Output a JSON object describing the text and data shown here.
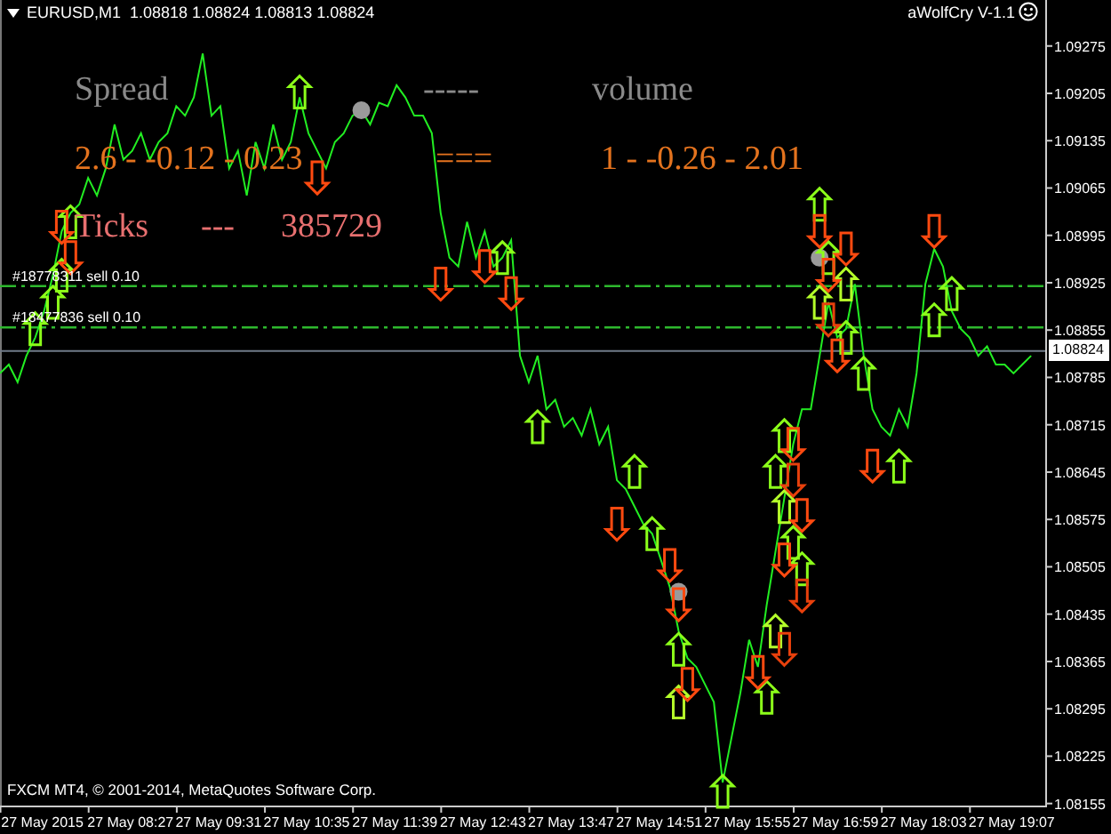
{
  "header": {
    "title": "EURUSD,M1  1.08818 1.08824 1.08813 1.08824",
    "expert": "aWolfCry V-1.1"
  },
  "indicator_rows": [
    {
      "color": "#8a8a8a",
      "cells": [
        "Spread",
        "-----",
        "volume"
      ]
    },
    {
      "color": "#e4731e",
      "cells": [
        "2.6 - -0.12 - 0.23",
        "===",
        "1 - -0.26 - 2.01"
      ]
    },
    {
      "color": "#e87070",
      "cells": [
        "Ticks",
        "---",
        "385729"
      ]
    }
  ],
  "copyright": "FXCM MT4, © 2001-2014, MetaQuotes Software Corp.",
  "chart_data": {
    "type": "line",
    "ylim": [
      1.08152,
      1.09343
    ],
    "categories": [
      null,
      null,
      null,
      null,
      null,
      "27 May 2015",
      null,
      null,
      null,
      null,
      null,
      null,
      null,
      null,
      null,
      "27 May 08:27",
      null,
      null,
      null,
      null,
      null,
      null,
      null,
      null,
      null,
      "27 May 09:31",
      null,
      null,
      null,
      null,
      null,
      null,
      null,
      null,
      null,
      "27 May 10:35",
      null,
      null,
      null,
      null,
      null,
      null,
      null,
      null,
      null,
      "27 May 11:39",
      null,
      null,
      null,
      null,
      null,
      null,
      null,
      null,
      null,
      "27 May 12:43",
      null,
      null,
      null,
      null,
      null,
      null,
      null,
      null,
      null,
      "27 May 13:47",
      null,
      null,
      null,
      null,
      null,
      null,
      null,
      null,
      null,
      "27 May 14:51",
      null,
      null,
      null,
      null,
      null,
      null,
      null,
      null,
      null,
      "27 May 15:55",
      null,
      null,
      null,
      null,
      null,
      null,
      null,
      null,
      null,
      "27 May 16:59",
      null,
      null,
      null,
      null,
      null,
      null,
      null,
      null,
      null,
      "27 May 18:03",
      null,
      null,
      null,
      null,
      null,
      null,
      null,
      null,
      null,
      "27 May 19:07",
      null,
      null
    ],
    "series": [
      {
        "color": "#22ee22",
        "values": [
          1.08791,
          1.08804,
          1.08778,
          1.08817,
          1.08844,
          1.08883,
          1.08936,
          1.09001,
          1.09028,
          1.09041,
          1.0908,
          1.09054,
          1.09094,
          1.09159,
          1.09107,
          1.0912,
          1.09146,
          1.09107,
          1.09133,
          1.09146,
          1.09186,
          1.09172,
          1.09199,
          1.09264,
          1.09172,
          1.09186,
          1.09094,
          1.0912,
          1.09054,
          1.09133,
          1.09094,
          1.09159,
          1.09107,
          1.09133,
          1.09199,
          1.09146,
          1.0912,
          1.09094,
          1.09133,
          1.09146,
          1.09172,
          1.0918,
          1.09159,
          1.09191,
          1.09186,
          1.09217,
          1.09199,
          1.09172,
          1.09172,
          1.09146,
          1.09028,
          1.08962,
          1.08949,
          1.09015,
          1.08962,
          1.09001,
          1.08949,
          1.08962,
          1.08988,
          1.08817,
          1.08778,
          1.08817,
          1.08738,
          1.08752,
          1.08712,
          1.08725,
          1.08699,
          1.08738,
          1.08686,
          1.08712,
          1.08633,
          1.0862,
          1.08594,
          1.08568,
          1.08554,
          1.08515,
          1.08475,
          1.0841,
          1.0837,
          1.08357,
          1.08331,
          1.08305,
          1.08186,
          1.08252,
          1.08318,
          1.08397,
          1.08357,
          1.08449,
          1.08528,
          1.08607,
          1.08686,
          1.08738,
          1.08738,
          1.08817,
          1.08896,
          1.08844,
          1.08857,
          1.08923,
          1.08817,
          1.08738,
          1.08712,
          1.08699,
          1.08738,
          1.08712,
          1.08791,
          1.08923,
          1.08975,
          1.08949,
          1.08883,
          1.08857,
          1.08844,
          1.08817,
          1.08831,
          1.08804,
          1.08804,
          1.08791,
          1.08804,
          1.08817
        ]
      },
      {
        "type": "scatter",
        "color": "#9a9a9a",
        "values": [
          null,
          null,
          null,
          null,
          null,
          null,
          null,
          null,
          null,
          null,
          null,
          null,
          null,
          null,
          null,
          null,
          null,
          null,
          null,
          null,
          null,
          null,
          null,
          null,
          null,
          null,
          null,
          null,
          null,
          null,
          null,
          null,
          null,
          null,
          null,
          null,
          null,
          null,
          null,
          null,
          null,
          1.0918,
          null,
          null,
          null,
          null,
          null,
          null,
          null,
          null,
          null,
          null,
          null,
          null,
          null,
          null,
          null,
          null,
          null,
          null,
          null,
          null,
          null,
          null,
          null,
          null,
          null,
          null,
          null,
          null,
          null,
          null,
          null,
          null,
          null,
          null,
          null,
          1.08468,
          null,
          null,
          null,
          null,
          null,
          null,
          null,
          null,
          null,
          null,
          null,
          null,
          null,
          null,
          null,
          1.08962,
          null,
          null,
          null,
          null,
          null,
          null,
          null,
          null,
          null,
          null,
          null,
          null,
          null,
          null,
          null,
          null,
          null,
          null,
          null,
          null,
          null,
          null,
          null,
          null
        ]
      },
      {
        "type": "scatter",
        "color": "#8cff1a",
        "values": [
          null,
          null,
          null,
          null,
          1.08857,
          null,
          1.08896,
          1.08936,
          1.09015,
          null,
          null,
          null,
          null,
          null,
          null,
          null,
          null,
          null,
          null,
          null,
          null,
          null,
          null,
          null,
          null,
          null,
          null,
          null,
          null,
          null,
          null,
          null,
          null,
          null,
          1.09207,
          null,
          null,
          null,
          null,
          null,
          null,
          null,
          null,
          null,
          null,
          null,
          null,
          null,
          null,
          null,
          null,
          null,
          null,
          null,
          null,
          null,
          null,
          1.08962,
          null,
          null,
          null,
          1.08712,
          null,
          null,
          null,
          null,
          null,
          null,
          null,
          null,
          null,
          null,
          1.08646,
          null,
          1.08554,
          null,
          null,
          1.08383,
          null,
          null,
          null,
          null,
          1.08173,
          null,
          null,
          null,
          null,
          1.08312,
          1.08646,
          1.08699,
          1.08541,
          1.08502,
          null,
          1.09041,
          1.08962,
          null,
          1.08844,
          null,
          1.08791,
          null,
          null,
          null,
          1.08654,
          null,
          null,
          null,
          1.0887,
          null,
          1.08909,
          null,
          null,
          null,
          null,
          null,
          null,
          null,
          null,
          null
        ]
      },
      {
        "type": "scatter",
        "color": "#b4ff2a",
        "values": [
          null,
          null,
          null,
          null,
          null,
          null,
          null,
          null,
          null,
          null,
          null,
          null,
          null,
          null,
          null,
          null,
          null,
          null,
          null,
          null,
          null,
          null,
          null,
          null,
          null,
          null,
          null,
          null,
          null,
          null,
          null,
          null,
          null,
          null,
          null,
          null,
          null,
          null,
          null,
          null,
          null,
          null,
          null,
          null,
          null,
          null,
          null,
          null,
          null,
          null,
          null,
          null,
          null,
          null,
          null,
          null,
          null,
          null,
          null,
          null,
          null,
          null,
          null,
          null,
          null,
          null,
          null,
          null,
          null,
          null,
          null,
          null,
          null,
          null,
          null,
          null,
          null,
          1.08305,
          null,
          null,
          null,
          null,
          null,
          null,
          null,
          null,
          null,
          null,
          1.0841,
          1.08594,
          null,
          null,
          null,
          1.08896,
          null,
          null,
          1.08923,
          null,
          null,
          null,
          null,
          null,
          null,
          null,
          null,
          null,
          null,
          null,
          null,
          null,
          null,
          null,
          null,
          null,
          null,
          null,
          null,
          null
        ]
      },
      {
        "type": "scatter",
        "color": "#ff4a10",
        "values": [
          null,
          null,
          null,
          null,
          null,
          null,
          null,
          1.09007,
          1.08962,
          null,
          null,
          null,
          null,
          null,
          null,
          null,
          null,
          null,
          null,
          null,
          null,
          null,
          null,
          null,
          null,
          null,
          null,
          null,
          null,
          null,
          null,
          null,
          null,
          null,
          null,
          null,
          1.0908,
          null,
          null,
          null,
          null,
          null,
          null,
          null,
          null,
          null,
          null,
          null,
          null,
          null,
          1.08923,
          null,
          null,
          null,
          null,
          1.08949,
          null,
          null,
          1.08909,
          null,
          null,
          null,
          null,
          null,
          null,
          null,
          null,
          null,
          null,
          null,
          1.08568,
          null,
          null,
          null,
          null,
          null,
          1.08507,
          1.08449,
          1.08331,
          null,
          null,
          null,
          null,
          null,
          null,
          null,
          1.08349,
          null,
          null,
          1.08515,
          1.08686,
          1.08581,
          null,
          1.09001,
          1.08936,
          1.08817,
          1.08975,
          null,
          null,
          1.08654,
          null,
          null,
          null,
          null,
          null,
          null,
          1.09001,
          null,
          null,
          null,
          null,
          null,
          null,
          null,
          null,
          null,
          null,
          null
        ]
      },
      {
        "type": "scatter",
        "color": "#e8400c",
        "values": [
          null,
          null,
          null,
          null,
          null,
          null,
          null,
          null,
          null,
          null,
          null,
          null,
          null,
          null,
          null,
          null,
          null,
          null,
          null,
          null,
          null,
          null,
          null,
          null,
          null,
          null,
          null,
          null,
          null,
          null,
          null,
          null,
          null,
          null,
          null,
          null,
          null,
          null,
          null,
          null,
          null,
          null,
          null,
          null,
          null,
          null,
          null,
          null,
          null,
          null,
          null,
          null,
          null,
          null,
          null,
          null,
          null,
          null,
          null,
          null,
          null,
          null,
          null,
          null,
          null,
          null,
          null,
          null,
          null,
          null,
          null,
          null,
          null,
          null,
          null,
          null,
          null,
          null,
          null,
          null,
          null,
          null,
          null,
          null,
          null,
          null,
          null,
          null,
          null,
          1.08383,
          1.08633,
          1.08462,
          null,
          null,
          1.0887,
          null,
          null,
          null,
          null,
          null,
          null,
          null,
          null,
          null,
          null,
          null,
          null,
          null,
          null,
          null,
          null,
          null,
          null,
          null,
          null,
          null,
          null,
          null
        ]
      }
    ],
    "ref_lines": [
      {
        "axis": "y",
        "value": 1.0892,
        "label": "#18778311 sell 0.10",
        "color": "#2eb82e"
      },
      {
        "axis": "y",
        "value": 1.08859,
        "label": "#18477836 sell 0.10",
        "color": "#2eb82e"
      },
      {
        "axis": "y",
        "value": 1.08824,
        "label": "1.08824",
        "color": "#6f7a88"
      }
    ],
    "yticks": [
      {
        "value": 1.09275,
        "label": "1.09275"
      },
      {
        "value": 1.09205,
        "label": "1.09205"
      },
      {
        "value": 1.09135,
        "label": "1.09135"
      },
      {
        "value": 1.09065,
        "label": "1.09065"
      },
      {
        "value": 1.08995,
        "label": "1.08995"
      },
      {
        "value": 1.08925,
        "label": "1.08925"
      },
      {
        "value": 1.08855,
        "label": "1.08855"
      },
      {
        "value": 1.08785,
        "label": "1.08785"
      },
      {
        "value": 1.08715,
        "label": "1.08715"
      },
      {
        "value": 1.08645,
        "label": "1.08645"
      },
      {
        "value": 1.08575,
        "label": "1.08575"
      },
      {
        "value": 1.08505,
        "label": "1.08505"
      },
      {
        "value": 1.08435,
        "label": "1.08435"
      },
      {
        "value": 1.08365,
        "label": "1.08365"
      },
      {
        "value": 1.08295,
        "label": "1.08295"
      },
      {
        "value": 1.08225,
        "label": "1.08225"
      },
      {
        "value": 1.08155,
        "label": "1.08155"
      }
    ]
  }
}
